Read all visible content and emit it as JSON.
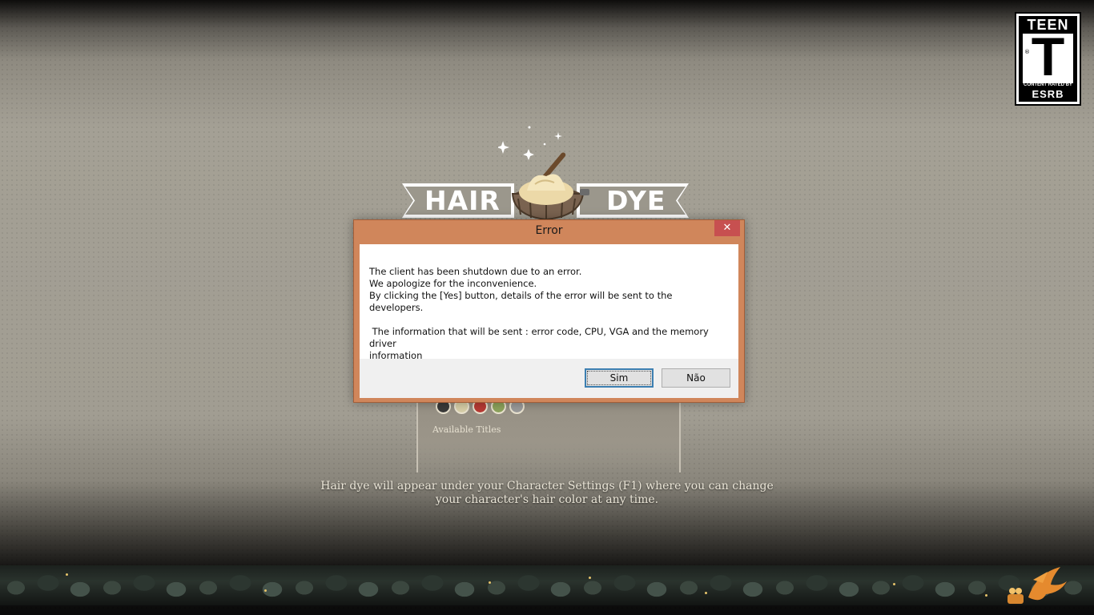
{
  "background": {
    "banner": {
      "left_word": "HAIR",
      "right_word": "DYE"
    },
    "swatch_colors": [
      "#3a3a3a",
      "#d8cfa8",
      "#b83a34",
      "#8da35c",
      "#9a9a9a"
    ],
    "available_titles_label": "Available Titles",
    "info_line1": "Hair dye will appear under your Character Settings (F1) where you can change",
    "info_line2": "your character's hair color at any time."
  },
  "esrb": {
    "top": "TEEN",
    "letter": "T",
    "small": "CONTENT RATED BY",
    "big": "ESRB",
    "reg": "®"
  },
  "dialog": {
    "title": "Error",
    "close_glyph": "✕",
    "lines": [
      "The client has been shutdown due to an error.",
      "We apologize for the inconvenience.",
      "By clicking the [Yes] button, details of the error will be sent to the developers.",
      "",
      " The information that will be sent : error code, CPU, VGA and the memory driver",
      "information"
    ],
    "yes_label": "Sim",
    "no_label": "Não"
  }
}
